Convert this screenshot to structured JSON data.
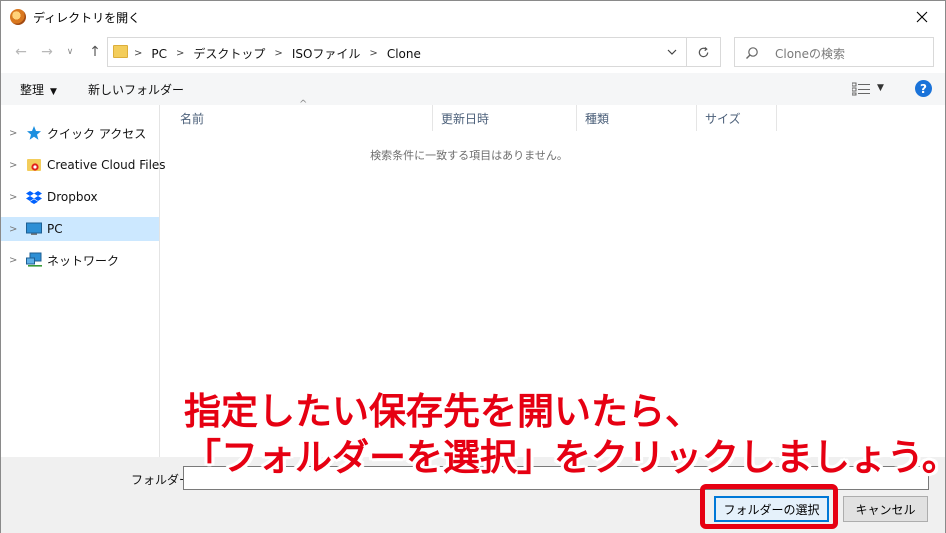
{
  "window": {
    "title": "ディレクトリを開く"
  },
  "address": {
    "crumbs": [
      "PC",
      "デスクトップ",
      "ISOファイル",
      "Clone"
    ],
    "search_placeholder": "Cloneの検索"
  },
  "toolbar": {
    "organize_label": "整理",
    "new_folder_label": "新しいフォルダー"
  },
  "nav": {
    "items": [
      {
        "label": "クイック アクセス",
        "icon": "star-icon"
      },
      {
        "label": "Creative Cloud Files",
        "icon": "creative-cloud-folder-icon"
      },
      {
        "label": "Dropbox",
        "icon": "dropbox-icon"
      },
      {
        "label": "PC",
        "icon": "monitor-icon",
        "selected": true
      },
      {
        "label": "ネットワーク",
        "icon": "network-icon"
      }
    ]
  },
  "list": {
    "columns": [
      "名前",
      "更新日時",
      "種類",
      "サイズ"
    ],
    "empty_message": "検索条件に一致する項目はありません。"
  },
  "footer": {
    "folder_label": "フォルダー:",
    "folder_value": "",
    "select_button": "フォルダーの選択",
    "cancel_button": "キャンセル"
  },
  "annotation": {
    "line1": "指定したい保存先を開いたら、",
    "line2": "「フォルダーを選択」をクリックしましょう。",
    "color": "#e60012"
  }
}
